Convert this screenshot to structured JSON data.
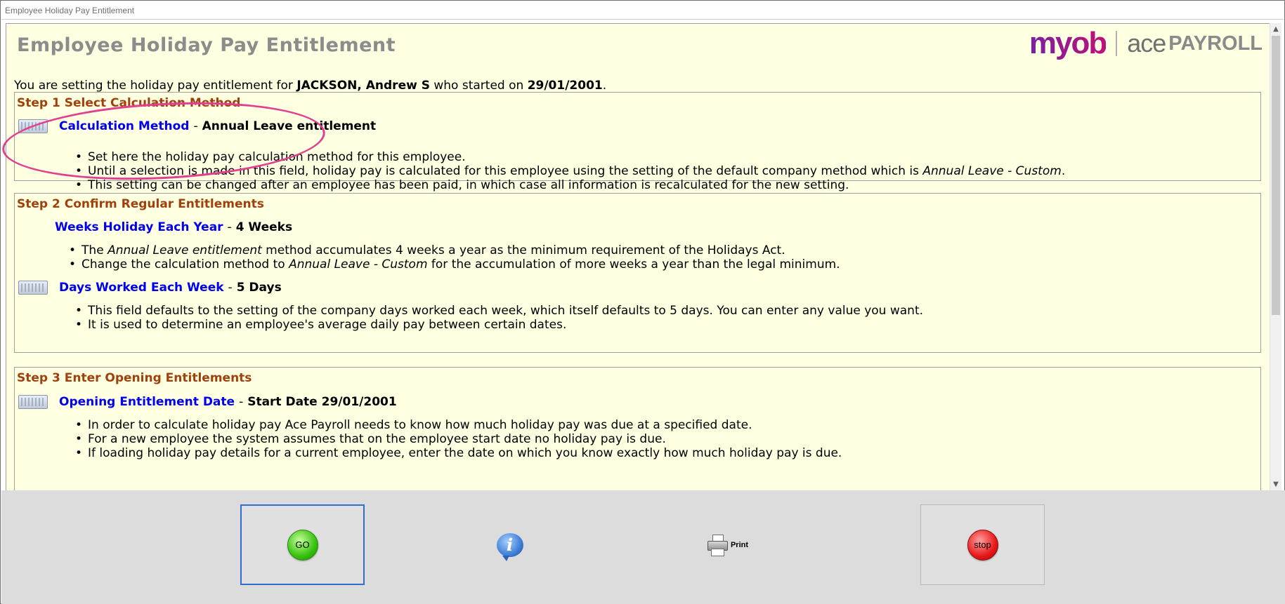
{
  "window": {
    "title": "Employee Holiday Pay Entitlement"
  },
  "header": {
    "page_title": "Employee Holiday Pay Entitlement",
    "logo": {
      "myob": "myob",
      "ace": "ace",
      "payroll": "PAYROLL"
    }
  },
  "intro": {
    "prefix": "You are setting the holiday pay entitlement for ",
    "employee": "JACKSON, Andrew S",
    "middle": " who started on ",
    "start_date": "29/01/2001",
    "suffix": "."
  },
  "step1": {
    "title": "Step 1 Select Calculation Method",
    "field": {
      "label": "Calculation Method",
      "dash": "-",
      "value": "Annual Leave entitlement"
    },
    "bullets": [
      "Set here the holiday pay calculation method for this employee.",
      "Until a selection is made in this field, holiday pay is calculated for this employee using the setting of the default company method which is ",
      "This setting can be changed after an employee has been paid, in which case all information is recalculated for the new setting."
    ],
    "bullet2_italic": "Annual Leave - Custom",
    "bullet2_end": "."
  },
  "step2": {
    "title": "Step 2 Confirm Regular Entitlements",
    "weeks": {
      "label": "Weeks Holiday Each Year",
      "dash": "-",
      "value": "4 Weeks"
    },
    "weeks_bullets": {
      "b1_pre": "The ",
      "b1_italic": "Annual Leave entitlement",
      "b1_post": " method accumulates 4 weeks a year as the minimum requirement of the Holidays Act.",
      "b2_pre": "Change the calculation method to ",
      "b2_italic": "Annual Leave - Custom",
      "b2_post": " for the accumulation of more weeks a year than the legal minimum."
    },
    "days": {
      "label": "Days Worked Each Week",
      "dash": "-",
      "value": "5 Days"
    },
    "days_bullets": [
      "This field defaults to the setting of the company days worked each week, which itself defaults to 5 days. You can enter any value you want.",
      "It is used to determine an employee's average daily pay between certain dates."
    ]
  },
  "step3": {
    "title": "Step 3 Enter Opening Entitlements",
    "field": {
      "label": "Opening Entitlement Date",
      "dash": "-",
      "value": "Start Date 29/01/2001"
    },
    "bullets": [
      "In order to calculate holiday pay Ace Payroll needs to know how much holiday pay was due at a specified date.",
      "For a new employee the system assumes that on the employee start date no holiday pay is due.",
      "If loading holiday pay details for a current employee, enter the date on which you know exactly how much holiday pay is due."
    ]
  },
  "footer": {
    "go_label": "GO",
    "info_glyph": "i",
    "print_label": "Print",
    "stop_label": "stop"
  },
  "colors": {
    "content_bg": "#ffffe1",
    "step_title": "#a0410d",
    "link": "#0000ee",
    "annotation": "#e0408f",
    "focus_border": "#2f6fd0"
  },
  "icons": [
    "keyboard-icon",
    "info-icon",
    "printer-icon",
    "go-orb-icon",
    "stop-orb-icon"
  ]
}
